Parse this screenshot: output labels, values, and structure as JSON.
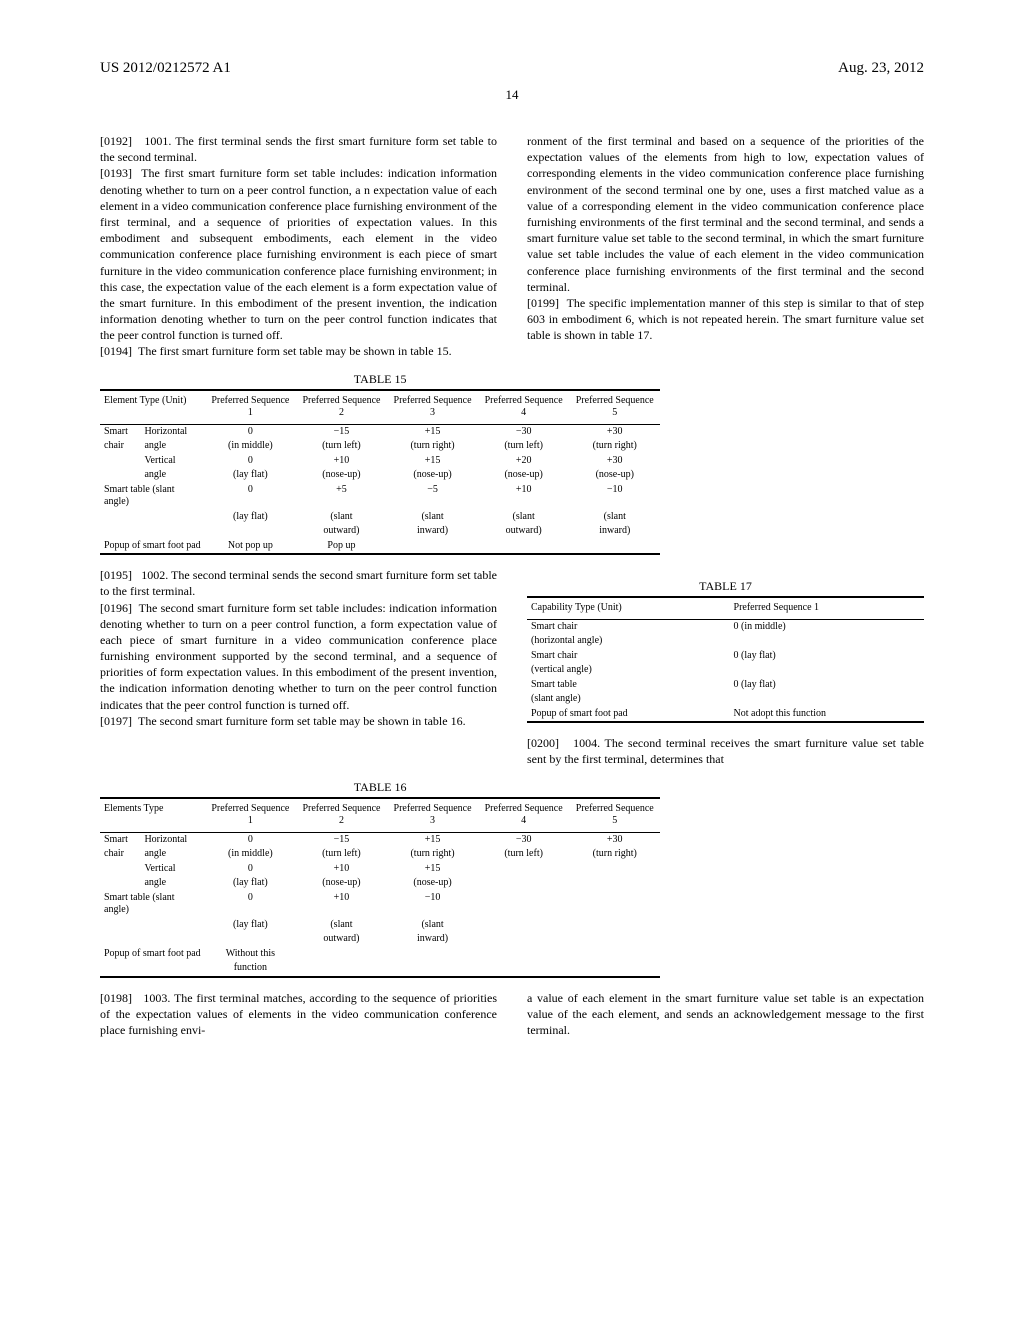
{
  "header": {
    "pub_number": "US 2012/0212572 A1",
    "pub_date": "Aug. 23, 2012"
  },
  "page_number": "14",
  "paragraphs": {
    "p0": "[0192]   1001. The first terminal sends the first smart furniture form set table to the second terminal.",
    "p1": "[0193]  The first smart furniture form set table includes: indication information denoting whether to turn on a peer control function, a n expectation value of each element in a video communication conference place furnishing environment of the first terminal, and a sequence of priorities of expectation values. In this embodiment and subsequent embodiments, each element in the video communication conference place furnishing environment is each piece of smart furniture in the video communication conference place furnishing environment; in this case, the expectation value of the each element is a form expectation value of the smart furniture. In this embodiment of the present invention, the indication information denoting whether to turn on the peer control function indicates that the peer control function is turned off.",
    "p2": "[0194]  The first smart furniture form set table may be shown in table 15.",
    "p3": "[0195]   1002. The second terminal sends the second smart furniture form set table to the first terminal.",
    "p4": "[0196]  The second smart furniture form set table includes: indication information denoting whether to turn on a peer control function, a form expectation value of each piece of smart furniture in a video communication conference place furnishing environment supported by the second terminal, and a sequence of priorities of form expectation values. In this embodiment of the present invention, the indication information denoting whether to turn on the peer control function indicates that the peer control function is turned off.",
    "p5": "[0197]  The second smart furniture form set table may be shown in table 16.",
    "p6": "[0198]   1003. The first terminal matches, according to the sequence of priorities of the expectation values of elements in the video communication conference place furnishing envi-",
    "p7": "ronment of the first terminal and based on a sequence of the priorities of the expectation values of the elements from high to low, expectation values of corresponding elements in the video communication conference place furnishing environment of the second terminal one by one, uses a first matched value as a value of a corresponding element in the video communication conference place furnishing environments of the first terminal and the second terminal, and sends a smart furniture value set table to the second terminal, in which the smart furniture value set table includes the value of each element in the video communication conference place furnishing environments of the first terminal and the second terminal.",
    "p8": "[0199]  The specific implementation manner of this step is similar to that of step 603 in embodiment 6, which is not repeated herein. The smart furniture value set table is shown in table 17.",
    "p9": "[0200]   1004. The second terminal receives the smart furniture value set table sent by the first terminal, determines that",
    "p10": "a value of each element in the smart furniture value set table is an expectation value of the each element, and sends an acknowledgement message to the first terminal."
  },
  "table15": {
    "caption": "TABLE 15",
    "headers": [
      "Element Type (Unit)",
      "Preferred Sequence 1",
      "Preferred Sequence 2",
      "Preferred Sequence 3",
      "Preferred Sequence 4",
      "Preferred Sequence 5"
    ],
    "rows": [
      {
        "c1a": "Smart",
        "c1b": "Horizontal",
        "s1": "0",
        "s2": "−15",
        "s3": "+15",
        "s4": "−30",
        "s5": "+30"
      },
      {
        "c1a": "chair",
        "c1b": "angle",
        "s1": "(in middle)",
        "s2": "(turn left)",
        "s3": "(turn right)",
        "s4": "(turn left)",
        "s5": "(turn right)"
      },
      {
        "c1a": "",
        "c1b": "Vertical",
        "s1": "0",
        "s2": "+10",
        "s3": "+15",
        "s4": "+20",
        "s5": "+30"
      },
      {
        "c1a": "",
        "c1b": "angle",
        "s1": "(lay flat)",
        "s2": "(nose-up)",
        "s3": "(nose-up)",
        "s4": "(nose-up)",
        "s5": "(nose-up)"
      },
      {
        "c1a": "Smart table (slant angle)",
        "c1b": "",
        "s1": "0",
        "s2": "+5",
        "s3": "−5",
        "s4": "+10",
        "s5": "−10"
      },
      {
        "c1a": "",
        "c1b": "",
        "s1": "(lay flat)",
        "s2": "(slant",
        "s3": "(slant",
        "s4": "(slant",
        "s5": "(slant"
      },
      {
        "c1a": "",
        "c1b": "",
        "s1": "",
        "s2": "outward)",
        "s3": "inward)",
        "s4": "outward)",
        "s5": "inward)"
      },
      {
        "c1a": "Popup of smart foot pad",
        "c1b": "",
        "s1": "Not pop up",
        "s2": "Pop up",
        "s3": "",
        "s4": "",
        "s5": ""
      }
    ]
  },
  "table16": {
    "caption": "TABLE 16",
    "headers": [
      "Elements Type",
      "Preferred Sequence 1",
      "Preferred Sequence 2",
      "Preferred Sequence 3",
      "Preferred Sequence 4",
      "Preferred Sequence 5"
    ],
    "rows": [
      {
        "c1a": "Smart",
        "c1b": "Horizontal",
        "s1": "0",
        "s2": "−15",
        "s3": "+15",
        "s4": "−30",
        "s5": "+30"
      },
      {
        "c1a": "chair",
        "c1b": "angle",
        "s1": "(in middle)",
        "s2": "(turn left)",
        "s3": "(turn right)",
        "s4": "(turn left)",
        "s5": "(turn right)"
      },
      {
        "c1a": "",
        "c1b": "Vertical",
        "s1": "0",
        "s2": "+10",
        "s3": "+15",
        "s4": "",
        "s5": ""
      },
      {
        "c1a": "",
        "c1b": "angle",
        "s1": "(lay flat)",
        "s2": "(nose-up)",
        "s3": "(nose-up)",
        "s4": "",
        "s5": ""
      },
      {
        "c1a": "Smart table (slant angle)",
        "c1b": "",
        "s1": "0",
        "s2": "+10",
        "s3": "−10",
        "s4": "",
        "s5": ""
      },
      {
        "c1a": "",
        "c1b": "",
        "s1": "(lay flat)",
        "s2": "(slant",
        "s3": "(slant",
        "s4": "",
        "s5": ""
      },
      {
        "c1a": "",
        "c1b": "",
        "s1": "",
        "s2": "outward)",
        "s3": "inward)",
        "s4": "",
        "s5": ""
      },
      {
        "c1a": "Popup of smart foot pad",
        "c1b": "",
        "s1": "Without this",
        "s2": "",
        "s3": "",
        "s4": "",
        "s5": ""
      },
      {
        "c1a": "",
        "c1b": "",
        "s1": "function",
        "s2": "",
        "s3": "",
        "s4": "",
        "s5": ""
      }
    ]
  },
  "table17": {
    "caption": "TABLE 17",
    "headers": [
      "Capability Type (Unit)",
      "Preferred Sequence 1"
    ],
    "rows": [
      {
        "c1": "Smart chair",
        "c2": "0 (in middle)"
      },
      {
        "c1": "(horizontal angle)",
        "c2": ""
      },
      {
        "c1": "Smart chair",
        "c2": "0 (lay flat)"
      },
      {
        "c1": "(vertical angle)",
        "c2": ""
      },
      {
        "c1": "Smart table",
        "c2": "0 (lay flat)"
      },
      {
        "c1": "(slant angle)",
        "c2": ""
      },
      {
        "c1": "Popup of smart foot pad",
        "c2": "Not adopt this function"
      }
    ]
  }
}
